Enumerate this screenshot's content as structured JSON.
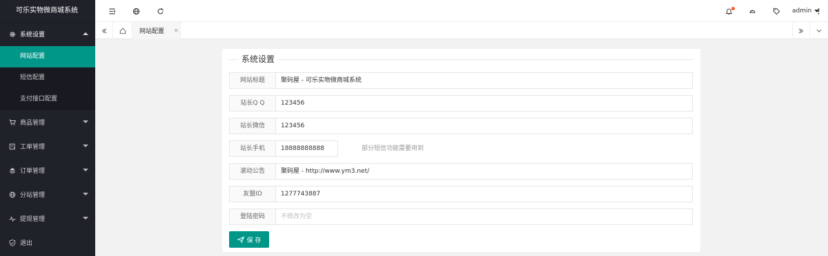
{
  "app": {
    "title": "可乐实物微商城系统"
  },
  "sidebar": {
    "items": [
      {
        "label": "系统设置",
        "icon": "gear-icon",
        "open": true,
        "children": [
          {
            "label": "网站配置",
            "active": true
          },
          {
            "label": "短信配置"
          },
          {
            "label": "支付接口配置"
          }
        ]
      },
      {
        "label": "商品管理",
        "icon": "cart-icon"
      },
      {
        "label": "工单管理",
        "icon": "ticket-icon"
      },
      {
        "label": "订单管理",
        "icon": "layers-icon"
      },
      {
        "label": "分站管理",
        "icon": "globe-icon"
      },
      {
        "label": "提现管理",
        "icon": "pulse-icon"
      },
      {
        "label": "退出",
        "icon": "shield-icon"
      }
    ]
  },
  "header": {
    "user": "admin"
  },
  "tabs": {
    "items": [
      {
        "label": "网站配置"
      }
    ]
  },
  "form": {
    "legend": "系统设置",
    "fields": [
      {
        "label": "网站标题",
        "value": "聚码屋 - 可乐实物微商城系统"
      },
      {
        "label": "站长Q Q",
        "value": "123456"
      },
      {
        "label": "站长微信",
        "value": "123456"
      },
      {
        "label": "站长手机",
        "value": "18888888888",
        "hint": "部分短信功能需要用到"
      },
      {
        "label": "滚动公告",
        "value": "聚码屋 - http://www.ym3.net/"
      },
      {
        "label": "友盟ID",
        "value": "1277743887"
      },
      {
        "label": "登陆密码",
        "value": "",
        "placeholder": "不修改为空"
      }
    ],
    "submit_label": "保 存"
  },
  "colors": {
    "accent": "#009688",
    "sidebar": "#20222a",
    "badge": "#ff5722"
  }
}
